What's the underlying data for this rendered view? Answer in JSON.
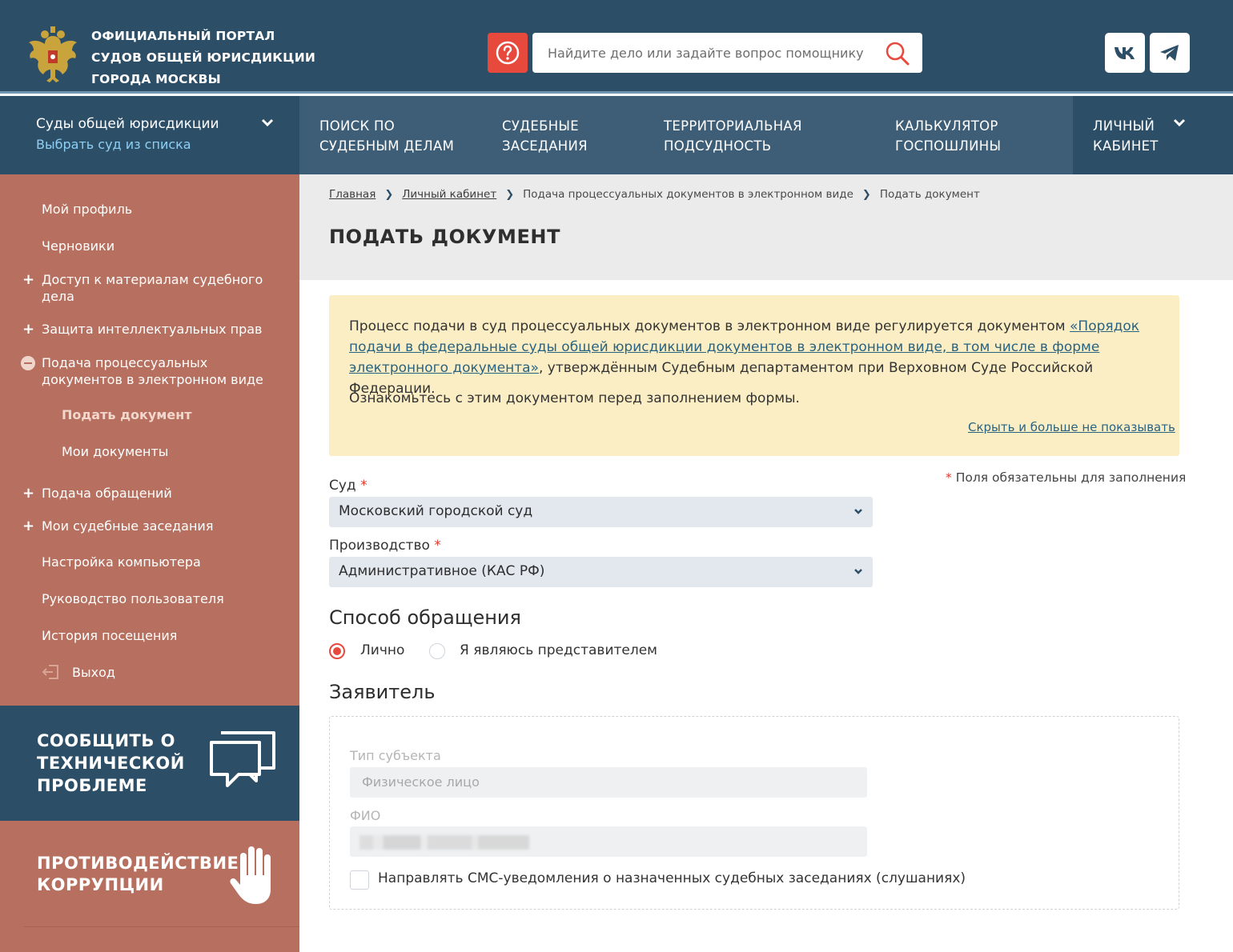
{
  "header": {
    "portal_title": [
      "ОФИЦИАЛЬНЫЙ ПОРТАЛ",
      "СУДОВ ОБЩЕЙ ЮРИСДИКЦИИ",
      "ГОРОДА МОСКВЫ"
    ],
    "search_placeholder": "Найдите дело или задайте вопрос помощнику",
    "help_icon": "question-circle-icon",
    "search_icon": "magnifier-icon",
    "social": [
      "vk-icon",
      "telegram-icon"
    ]
  },
  "nav": {
    "court_select_title": "Суды общей юрисдикции",
    "court_select_link": "Выбрать суд из списка",
    "items": [
      [
        "ПОИСК ПО",
        "СУДЕБНЫМ ДЕЛАМ"
      ],
      [
        "СУДЕБНЫЕ",
        "ЗАСЕДАНИЯ"
      ],
      [
        "ТЕРРИТОРИАЛЬНАЯ",
        "ПОДСУДНОСТЬ"
      ],
      [
        "КАЛЬКУЛЯТОР",
        "ГОСПОШЛИНЫ"
      ]
    ],
    "cabinet": [
      "ЛИЧНЫЙ",
      "КАБИНЕТ"
    ]
  },
  "sidebar": {
    "items": [
      {
        "label": "Мой профиль"
      },
      {
        "label": "Черновики"
      },
      {
        "label": "Доступ к материалам судебного дела",
        "lines": [
          "Доступ к материалам судебного",
          "дела"
        ]
      },
      {
        "label": "Защита интеллектуальных прав"
      },
      {
        "label": "Подача процессуальных документов в электронном виде",
        "lines": [
          "Подача процессуальных",
          "документов в электронном виде"
        ]
      },
      {
        "label": "Подать документ"
      },
      {
        "label": "Мои документы"
      },
      {
        "label": "Подача обращений"
      },
      {
        "label": "Мои судебные заседания"
      },
      {
        "label": "Настройка компьютера"
      },
      {
        "label": "Руководство пользователя"
      },
      {
        "label": "История посещения"
      },
      {
        "label": "Выход"
      }
    ],
    "tech_block": [
      "СООБЩИТЬ О",
      "ТЕХНИЧЕСКОЙ",
      "ПРОБЛЕМЕ"
    ],
    "corruption_block": [
      "ПРОТИВОДЕЙСТВИЕ",
      "КОРРУПЦИИ"
    ]
  },
  "breadcrumb": [
    "Главная",
    "Личный кабинет",
    "Подача процессуальных документов в электронном виде",
    "Подать документ"
  ],
  "page_title": "ПОДАТЬ ДОКУМЕНТ",
  "notice": {
    "text_before_link": "Процесс подачи в суд процессуальных документов в электронном виде регулируется документом ",
    "link_text": "«Порядок подачи в федеральные суды общей юрисдикции документов в электронном виде, в том числе в форме электронного документа»",
    "text_after_link": ", утверждённым Судебным департаментом при Верховном Суде Российской Федерации.",
    "second_paragraph": "Ознакомьтесь с этим документом перед заполнением формы.",
    "hide_link": "Скрыть и больше не показывать"
  },
  "form": {
    "required_note": "Поля обязательны для заполнения",
    "required_star": "*",
    "court_label": "Суд",
    "court_value": "Московский городской суд",
    "proceeding_label": "Производство",
    "proceeding_value": "Административное (КАС РФ)",
    "method_title": "Способ обращения",
    "method_options": [
      "Лично",
      "Я являюсь представителем"
    ],
    "method_selected": "Лично",
    "applicant_title": "Заявитель",
    "subject_type_label": "Тип субъекта",
    "subject_type_value": "Физическое лицо",
    "fio_label": "ФИО",
    "sms_label": "Направлять СМС-уведомления о назначенных судебных заседаниях (слушаниях)",
    "sms_checked": false
  },
  "colors": {
    "header_bg": "#2d4e67",
    "nav_bg": "#3e5e77",
    "sidebar_bg": "#b7705f",
    "accent_red": "#e8493d",
    "notice_bg": "#fbeec4"
  }
}
